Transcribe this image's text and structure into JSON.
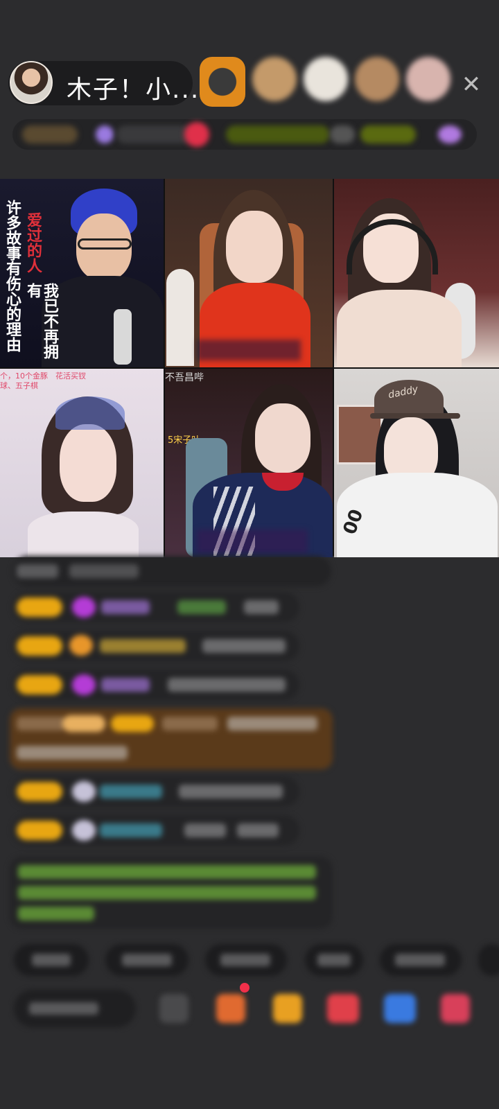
{
  "header": {
    "host_name": "木子！小...",
    "close_icon": "close-icon"
  },
  "lyrics": {
    "right_column": "许多故事有伤心的理由",
    "left_column_red": "爱过的人",
    "left_column_white": "我已不再拥有"
  },
  "overlays": {
    "tile4_top_line1": "个，10个金豚　花活买钗",
    "tile4_top_line2": "球、五子棋",
    "tile5_top": "不吾昌哔",
    "tile5_side": "5宋子叶",
    "tile6_cap": "daddy",
    "tile6_jersey": "00"
  },
  "colors": {
    "background": "#2c2c2e",
    "badge_gold": "#e8a612",
    "gem_purple": "#b43cd6",
    "chat_green": "#8ad14a",
    "highlight_brown": "#5a3a1a"
  }
}
